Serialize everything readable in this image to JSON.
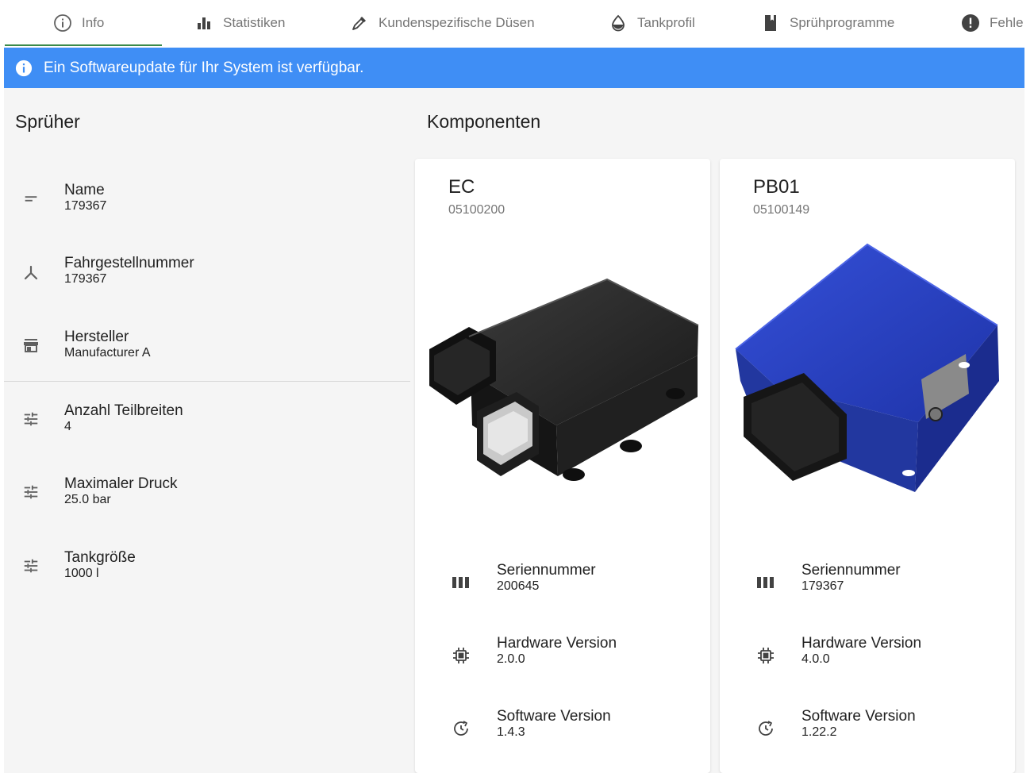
{
  "tabs": [
    {
      "label": "Info",
      "icon": "info-circle-icon",
      "active": true
    },
    {
      "label": "Statistiken",
      "icon": "bar-chart-icon",
      "active": false
    },
    {
      "label": "Kundenspezifische Düsen",
      "icon": "eyedropper-icon",
      "active": false
    },
    {
      "label": "Tankprofil",
      "icon": "water-drop-icon",
      "active": false
    },
    {
      "label": "Sprühprogramme",
      "icon": "bookmark-icon",
      "active": false
    },
    {
      "label": "Fehle",
      "icon": "error-icon",
      "active": false
    }
  ],
  "banner": {
    "text": "Ein Softwareupdate für Ihr System ist verfügbar.",
    "icon": "info-filled-icon",
    "color": "#3f8ef5"
  },
  "sprayer": {
    "title": "Sprüher",
    "properties": [
      {
        "label": "Name",
        "value": "179367",
        "icon": "short-text-icon"
      },
      {
        "label": "Fahrgestellnummer",
        "value": "179367",
        "icon": "merge-icon"
      },
      {
        "label": "Hersteller",
        "value": "Manufacturer A",
        "icon": "store-icon"
      },
      {
        "label": "Anzahl Teilbreiten",
        "value": "4",
        "icon": "tune-icon"
      },
      {
        "label": "Maximaler Druck",
        "value": "25.0 bar",
        "icon": "tune-icon"
      },
      {
        "label": "Tankgröße",
        "value": "1000 l",
        "icon": "tune-icon"
      }
    ]
  },
  "components": {
    "title": "Komponenten",
    "cards": [
      {
        "name": "EC",
        "part_number": "05100200",
        "image": "black-ecu-module",
        "rows": [
          {
            "label": "Seriennummer",
            "value": "200645",
            "icon": "barcode-icon"
          },
          {
            "label": "Hardware Version",
            "value": "2.0.0",
            "icon": "chip-icon"
          },
          {
            "label": "Software Version",
            "value": "1.4.3",
            "icon": "update-icon"
          }
        ]
      },
      {
        "name": "PB01",
        "part_number": "05100149",
        "image": "blue-control-box",
        "rows": [
          {
            "label": "Seriennummer",
            "value": "179367",
            "icon": "barcode-icon"
          },
          {
            "label": "Hardware Version",
            "value": "4.0.0",
            "icon": "chip-icon"
          },
          {
            "label": "Software Version",
            "value": "1.22.2",
            "icon": "update-icon"
          }
        ]
      }
    ]
  },
  "colors": {
    "accent_tab_indicator": "#3a8a4a",
    "banner": "#3f8ef5",
    "panel_background": "#f5f5f5"
  }
}
